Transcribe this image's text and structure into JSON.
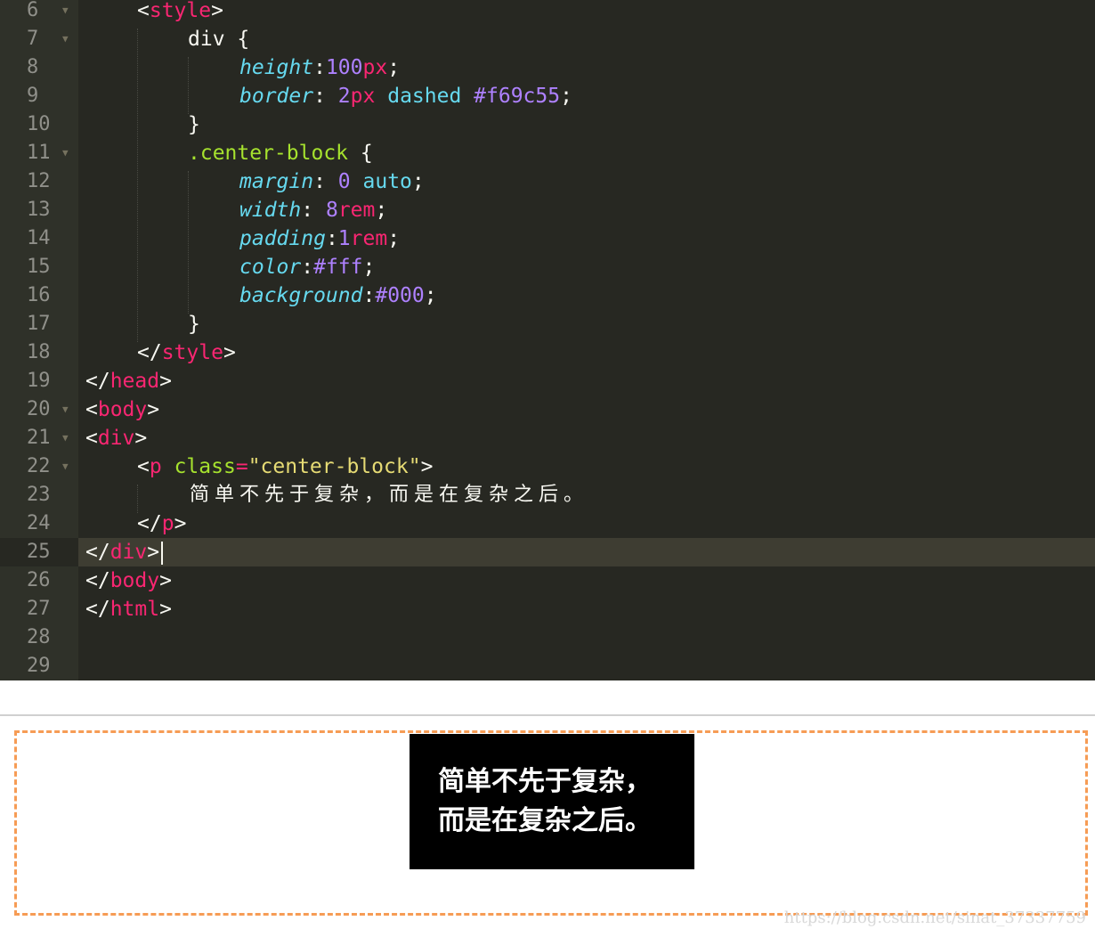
{
  "editor": {
    "active_line": "25",
    "lines": [
      {
        "n": "6"
      },
      {
        "n": "7"
      },
      {
        "n": "8"
      },
      {
        "n": "9"
      },
      {
        "n": "10"
      },
      {
        "n": "11"
      },
      {
        "n": "12"
      },
      {
        "n": "13"
      },
      {
        "n": "14"
      },
      {
        "n": "15"
      },
      {
        "n": "16"
      },
      {
        "n": "17"
      },
      {
        "n": "18"
      },
      {
        "n": "19"
      },
      {
        "n": "20"
      },
      {
        "n": "21"
      },
      {
        "n": "22"
      },
      {
        "n": "23"
      },
      {
        "n": "24"
      },
      {
        "n": "25"
      },
      {
        "n": "26"
      },
      {
        "n": "27"
      },
      {
        "n": "28"
      },
      {
        "n": "29"
      }
    ],
    "code": {
      "style_tag": "style",
      "div_sel": "div",
      "height_prop": "height",
      "height_val": "100",
      "height_unit": "px",
      "border_prop": "border",
      "border_val": "2",
      "border_unit": "px",
      "border_style": "dashed",
      "border_color": "#f69c55",
      "class_sel": ".center-block",
      "margin_prop": "margin",
      "margin_val": "0",
      "margin_auto": "auto",
      "width_prop": "width",
      "width_val": "8",
      "width_unit": "rem",
      "padding_prop": "padding",
      "padding_val": "1",
      "padding_unit": "rem",
      "color_prop": "color",
      "color_val": "#fff",
      "bg_prop": "background",
      "bg_val": "#000",
      "head_tag": "head",
      "body_tag": "body",
      "div_tag": "div",
      "p_tag": "p",
      "class_attr": "class",
      "class_value": "\"center-block\"",
      "text": "简单不先于复杂，而是在复杂之后。",
      "html_tag": "html"
    }
  },
  "preview": {
    "line1": "简单不先于复杂，",
    "line2": "而是在复杂之后。"
  },
  "watermark": "https://blog.csdn.net/sinat_37337759",
  "colors": {
    "editor_bg": "#272822",
    "dashed_border": "#f69c55",
    "block_bg": "#000000",
    "block_text": "#ffffff"
  }
}
